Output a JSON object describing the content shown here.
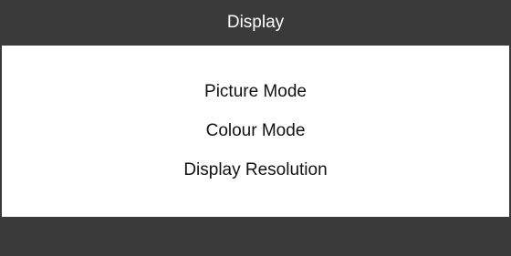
{
  "header": {
    "title": "Display"
  },
  "menu": {
    "items": [
      {
        "label": "Picture Mode"
      },
      {
        "label": "Colour Mode"
      },
      {
        "label": "Display Resolution"
      }
    ]
  },
  "colors": {
    "bar_background": "#3a3a3a",
    "panel_background": "#ffffff",
    "title_text": "#ffffff",
    "item_text": "#111111"
  }
}
